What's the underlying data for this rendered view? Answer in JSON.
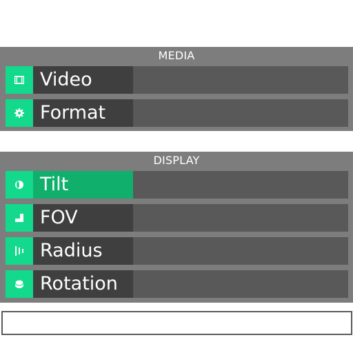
{
  "media": {
    "title": "MEDIA",
    "items": [
      {
        "label": "Video",
        "icon": "film-icon"
      },
      {
        "label": "Format",
        "icon": "gear-icon"
      }
    ]
  },
  "display": {
    "title": "DISPLAY",
    "items": [
      {
        "label": "Tilt",
        "icon": "tilt-icon",
        "active": true
      },
      {
        "label": "FOV",
        "icon": "fov-icon"
      },
      {
        "label": "Radius",
        "icon": "radius-icon"
      },
      {
        "label": "Rotation",
        "icon": "rotation-icon"
      }
    ]
  },
  "colors": {
    "accent": "#12d98b",
    "active_row": "#10b06c",
    "panel": "#7d7d7d",
    "row": "#595959",
    "label_bg": "#3f3f3f"
  }
}
